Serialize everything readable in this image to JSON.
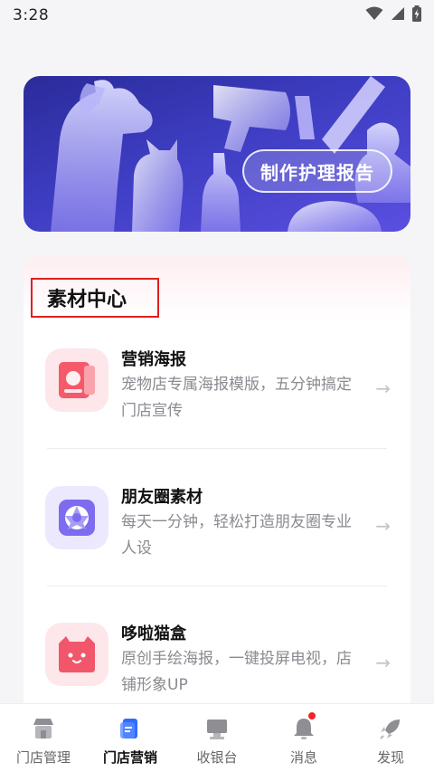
{
  "status_bar": {
    "time": "3:28"
  },
  "banner": {
    "button_label": "制作护理报告"
  },
  "materials": {
    "title": "素材中心",
    "items": [
      {
        "name": "营销海报",
        "desc": "宠物店专属海报模版，五分钟搞定门店宣传",
        "icon": "poster-icon",
        "arrow": "→"
      },
      {
        "name": "朋友圈素材",
        "desc": "每天一分钟，轻松打造朋友圈专业人设",
        "icon": "aperture-icon",
        "arrow": "→"
      },
      {
        "name": "哆啦猫盒",
        "desc": "原创手绘海报，一键投屏电视，店铺形象UP",
        "icon": "cat-box-icon",
        "arrow": "→"
      }
    ]
  },
  "tabbar": {
    "items": [
      {
        "label": "门店管理",
        "icon": "store-icon",
        "active": false
      },
      {
        "label": "门店营销",
        "icon": "marketing-icon",
        "active": true
      },
      {
        "label": "收银台",
        "icon": "cashier-icon",
        "active": false
      },
      {
        "label": "消息",
        "icon": "bell-icon",
        "active": false,
        "badge": true
      },
      {
        "label": "发现",
        "icon": "rocket-icon",
        "active": false
      }
    ]
  },
  "colors": {
    "accent_blue": "#2f6bff",
    "banner_start": "#2b2b9a",
    "banner_end": "#5b4fe0",
    "badge_red": "#f0232a",
    "poster_red": "#f45a6a",
    "aperture_purple": "#7d6cf0",
    "catbox_red": "#f2566a"
  }
}
